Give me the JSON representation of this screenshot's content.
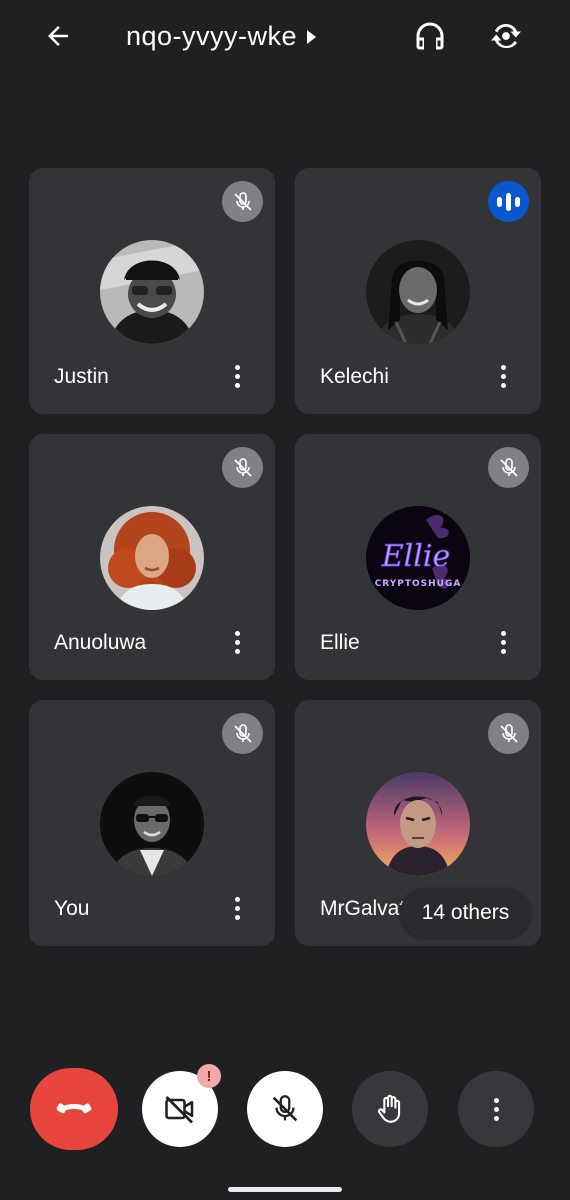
{
  "header": {
    "meeting_code": "nqo-yvyy-wke",
    "back_icon": "arrow-back-icon",
    "audio_icon": "headphones-icon",
    "switch_icon": "switch-camera-icon"
  },
  "participants": [
    {
      "name": "Justin",
      "status": "muted"
    },
    {
      "name": "Kelechi",
      "status": "speaking"
    },
    {
      "name": "Anuoluwa",
      "status": "muted"
    },
    {
      "name": "Ellie",
      "status": "muted"
    },
    {
      "name": "You",
      "status": "muted"
    },
    {
      "name": "MrGalvath",
      "status": "muted"
    }
  ],
  "ellie_avatar_text": {
    "main": "Ellie",
    "sub": "CRYPTOSHUGA"
  },
  "others_label": "14 others",
  "controls": {
    "end_call_icon": "call-end-icon",
    "camera_icon": "camera-off-icon",
    "camera_badge": "!",
    "mic_icon": "mic-off-icon",
    "hand_icon": "raise-hand-icon",
    "more_icon": "more-vert-icon"
  },
  "colors": {
    "background": "#1f2022",
    "tile": "#333437",
    "speaking_accent": "#0b57d0",
    "end_call": "#e8453c"
  }
}
